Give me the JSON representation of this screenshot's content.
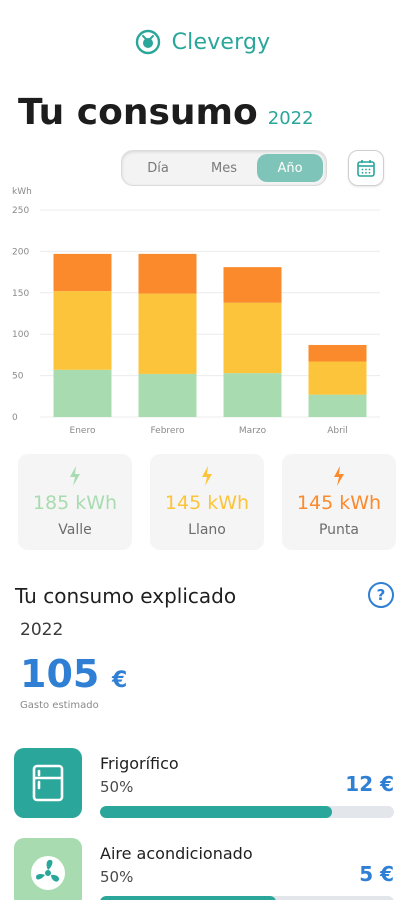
{
  "header": {
    "brand": "Clevergy"
  },
  "page": {
    "title": "Tu consumo",
    "year": "2022"
  },
  "period_toggle": {
    "options": [
      "Día",
      "Mes",
      "Año"
    ],
    "selected": "Año"
  },
  "colors": {
    "valle": "#a8dcb0",
    "llano": "#fcc43a",
    "punta": "#fb8a2c",
    "accent": "#2aa69a",
    "blue": "#2f7fd4"
  },
  "chart_data": {
    "type": "bar",
    "stacked": true,
    "ylabel": "kWh",
    "ylim": [
      0,
      250
    ],
    "yticks": [
      0,
      50,
      100,
      150,
      200,
      250
    ],
    "categories": [
      "Enero",
      "Febrero",
      "Marzo",
      "Abril"
    ],
    "series": [
      {
        "name": "Valle",
        "values": [
          57,
          52,
          53,
          27
        ]
      },
      {
        "name": "Llano",
        "values": [
          95,
          97,
          85,
          40
        ]
      },
      {
        "name": "Punta",
        "values": [
          45,
          48,
          43,
          20
        ]
      }
    ],
    "grid": true
  },
  "summary_cards": [
    {
      "value": "185 kWh",
      "label": "Valle",
      "color": "#a8dcb0"
    },
    {
      "value": "145 kWh",
      "label": "Llano",
      "color": "#fcc43a"
    },
    {
      "value": "145 kWh",
      "label": "Punta",
      "color": "#fb8a2c"
    }
  ],
  "explained": {
    "title": "Tu consumo explicado",
    "year": "2022",
    "amount": "105",
    "currency": "€",
    "amount_label": "Gasto estimado"
  },
  "appliances": [
    {
      "name": "Frigorífico",
      "percent": "50%",
      "fraction": 0.79,
      "cost": "12 €",
      "icon": "fridge-icon"
    },
    {
      "name": "Aire acondicionado",
      "percent": "50%",
      "fraction": 0.6,
      "cost": "5 €",
      "icon": "fan-icon"
    }
  ]
}
